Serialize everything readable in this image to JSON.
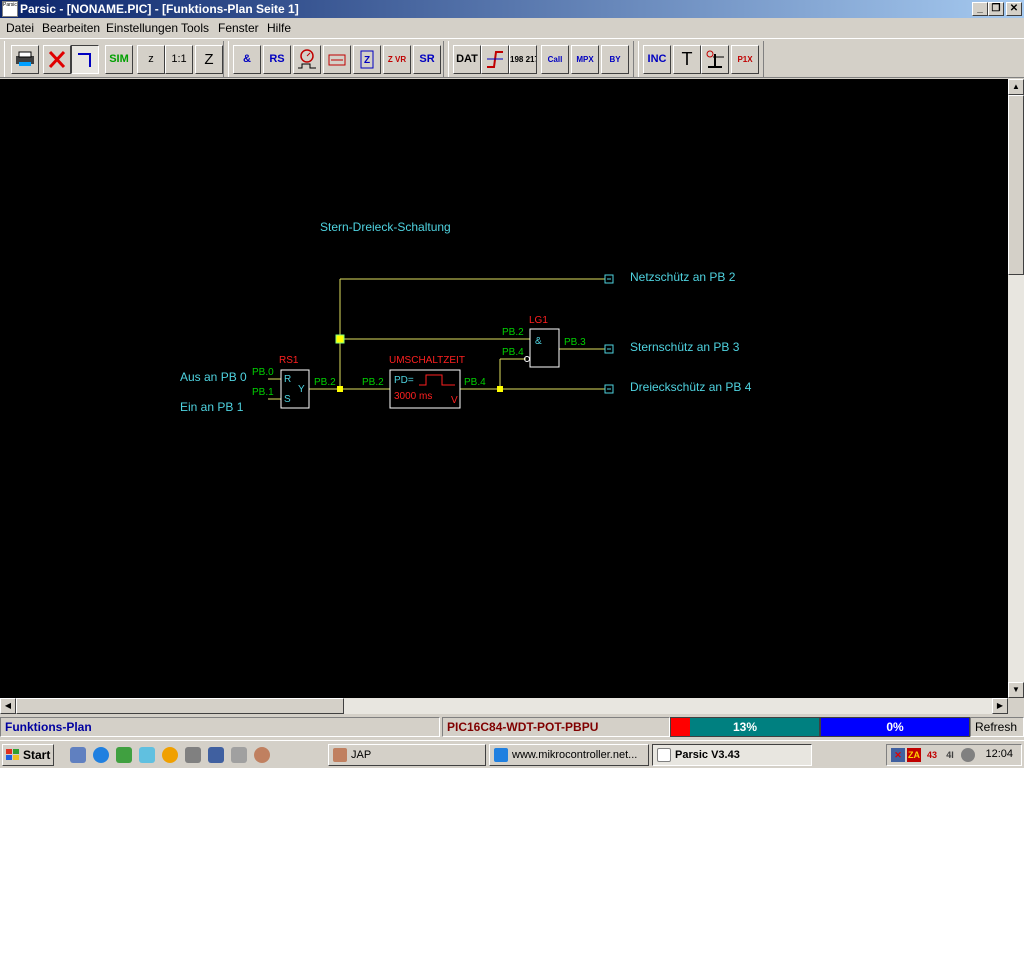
{
  "window": {
    "title": "Parsic - [NONAME.PIC] - [Funktions-Plan Seite 1]",
    "minimize": "_",
    "restore": "❐",
    "close": "✕"
  },
  "menu": [
    "Datei",
    "Bearbeiten",
    "Einstellungen",
    "Tools",
    "Fenster",
    "Hilfe"
  ],
  "toolbar": {
    "group1": [
      "",
      "",
      "",
      "SIM",
      "z",
      "1:1",
      "Z"
    ],
    "group2": [
      "&",
      "RS",
      "",
      "",
      "Z",
      "Z VR",
      "SR"
    ],
    "group3": [
      "DAT",
      "",
      "198 217",
      "Call",
      "MPX",
      "BY"
    ],
    "group4": [
      "INC",
      "T",
      "",
      "P1X"
    ]
  },
  "diagram": {
    "title": "Stern-Dreieck-Schaltung",
    "inputs": [
      {
        "label": "Aus an PB 0",
        "pin": "PB.0"
      },
      {
        "label": "Ein an PB 1",
        "pin": "PB.1"
      }
    ],
    "rs_block": {
      "name": "RS1",
      "r": "R",
      "s": "S",
      "y": "Y",
      "out_pin": "PB.2"
    },
    "timer_block": {
      "name": "UMSCHALTZEIT",
      "in_pin": "PB.2",
      "pd": "PD=",
      "time": "3000 ms",
      "v": "V",
      "out_pin": "PB.4"
    },
    "logic_block": {
      "name": "LG1",
      "op": "&",
      "in1": "PB.2",
      "in2": "PB.4",
      "out_pin": "PB.3"
    },
    "outputs": [
      {
        "label": "Netzschütz an PB 2"
      },
      {
        "label": "Sternschütz an PB 3"
      },
      {
        "label": "Dreieckschütz an PB 4"
      }
    ]
  },
  "status": {
    "mode": "Funktions-Plan",
    "device": "PIC16C84-WDT-POT-PBPU",
    "progress1": {
      "label": "13%",
      "fraction": 0.13,
      "fill_color": "#ff0000",
      "bg_color": "#008080"
    },
    "progress2": {
      "label": "0%",
      "fraction": 0.0,
      "bg_color": "#0000ff"
    },
    "refresh": "Refresh"
  },
  "taskbar": {
    "start": "Start",
    "tasks": [
      {
        "label": "JAP"
      },
      {
        "label": "www.mikrocontroller.net..."
      },
      {
        "label": "Parsic V3.43",
        "active": true
      }
    ],
    "tray_icons": [
      "ZA",
      "43",
      "4I"
    ],
    "clock": "12:04"
  },
  "colors": {
    "wire": "#e0e060",
    "label_cyan": "#4fd3e0",
    "pin_green": "#00d000",
    "name_red": "#ff2020",
    "junction": "#ffff00",
    "terminal": "#4fd3e0"
  }
}
